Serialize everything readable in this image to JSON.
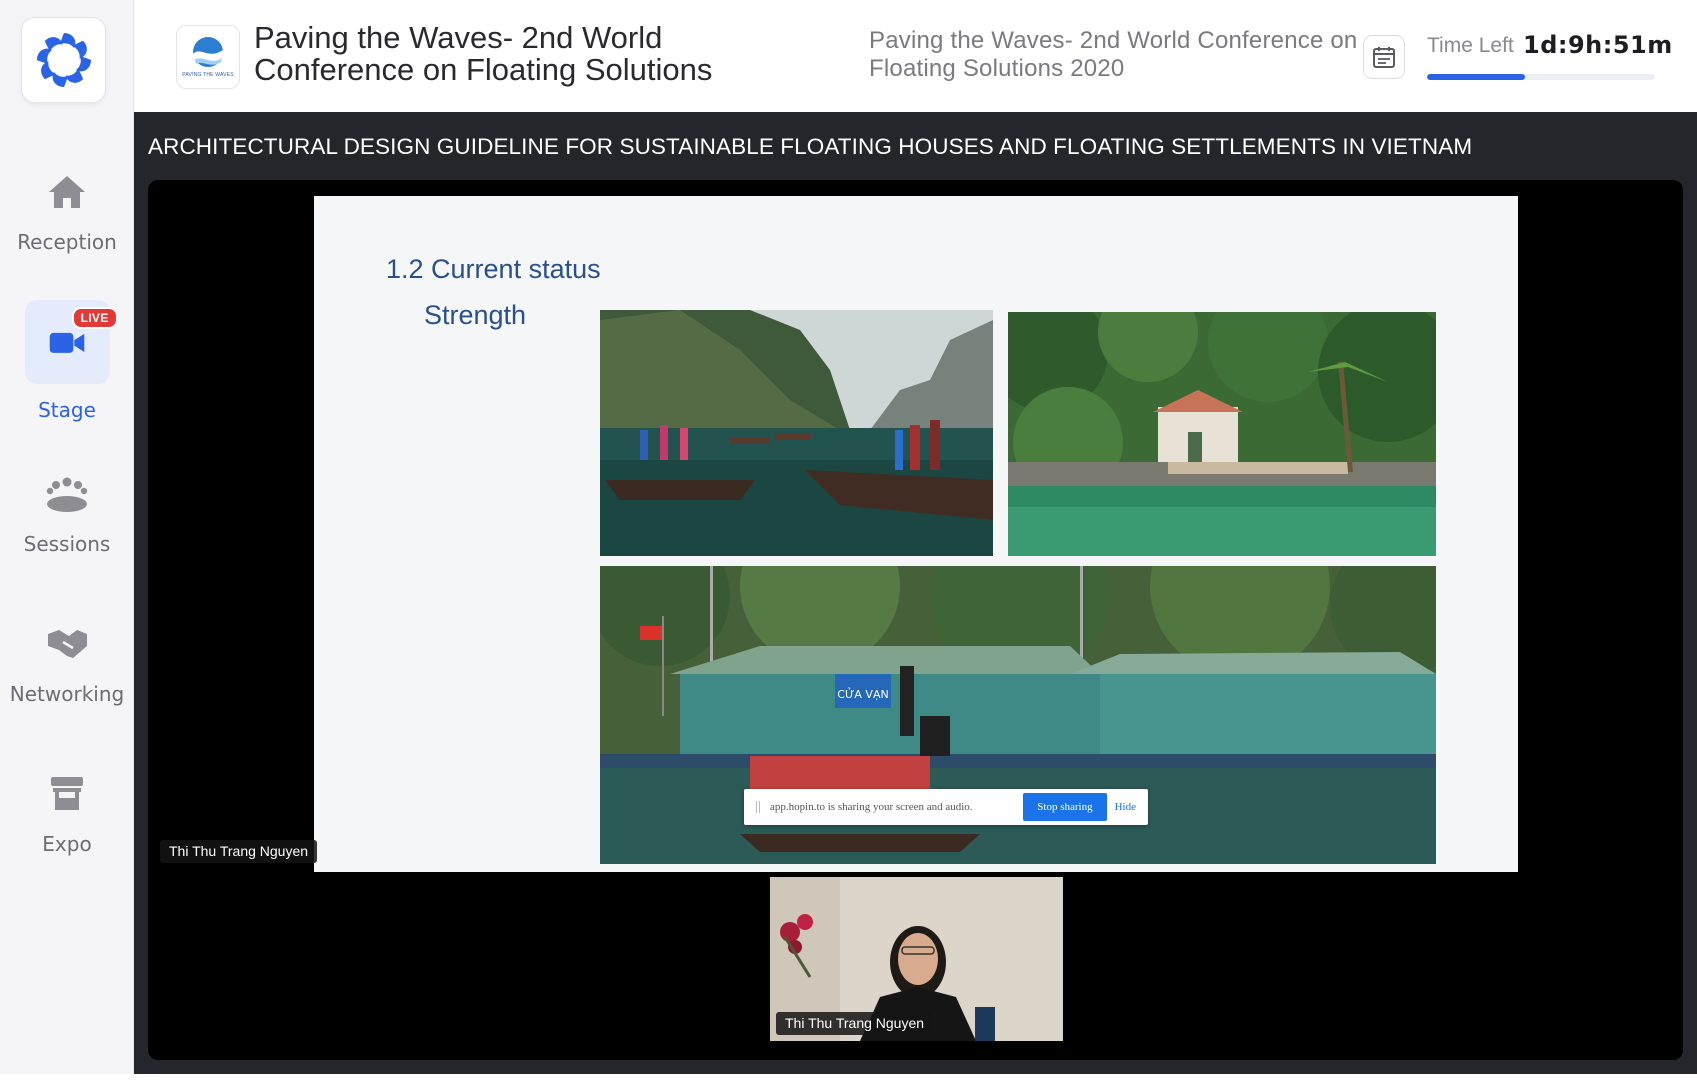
{
  "sidebar": {
    "logo_icon": "hopin-swirl-logo-icon",
    "items": [
      {
        "label": "Reception",
        "icon": "home-icon",
        "active": false
      },
      {
        "label": "Stage",
        "icon": "video-camera-icon",
        "active": true,
        "badge": "LIVE"
      },
      {
        "label": "Sessions",
        "icon": "group-icon",
        "active": false
      },
      {
        "label": "Networking",
        "icon": "handshake-icon",
        "active": false
      },
      {
        "label": "Expo",
        "icon": "booth-icon",
        "active": false
      }
    ]
  },
  "header": {
    "event_title": "Paving the Waves- 2nd World Conference on Floating Solutions",
    "event_subtitle": "Paving the Waves- 2nd World Conference on Floating Solutions 2020",
    "event_logo_text": "PAVING THE WAVES",
    "calendar_icon": "calendar-icon",
    "time_left_label": "Time Left",
    "time_left_value": "1d:9h:51m",
    "time_progress_percent": 43
  },
  "stage": {
    "session_title": "ARCHITECTURAL DESIGN GUIDELINE FOR SUSTAINABLE FLOATING HOUSES AND FLOATING SETTLEMENTS IN VIETNAM",
    "slide": {
      "heading": "1.2 Current status",
      "subheading": "Strength",
      "photo_signs": [
        "CỬA VẠN"
      ]
    },
    "screen_share_bar": {
      "message": "app.hopin.to is sharing your screen and audio.",
      "stop_label": "Stop sharing",
      "hide_label": "Hide"
    },
    "presenter_name": "Thi Thu Trang Nguyen",
    "speaker_name": "Thi Thu Trang Nguyen"
  },
  "colors": {
    "accent": "#2c62e8",
    "live": "#e23939",
    "stage_bg": "#24262c",
    "slide_heading": "#2b4f8a"
  }
}
